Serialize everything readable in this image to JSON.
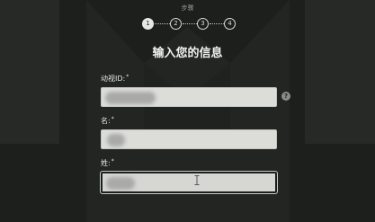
{
  "stepper": {
    "title": "步骤",
    "steps": [
      "1",
      "2",
      "3",
      "4"
    ],
    "active_index": 0
  },
  "heading": "输入您的信息",
  "fields": {
    "anime_id": {
      "label": "动视ID:",
      "required": "*",
      "value": "",
      "help_icon": "question-mark-icon"
    },
    "given_name": {
      "label": "名:",
      "required": "*",
      "value": ""
    },
    "surname": {
      "label": "姓:",
      "required": "*",
      "value": ""
    }
  },
  "help_icon_glyph": "?",
  "colors": {
    "background": "#1c1f1c",
    "input_background": "#dcddd9",
    "text": "#f1f2ef"
  }
}
